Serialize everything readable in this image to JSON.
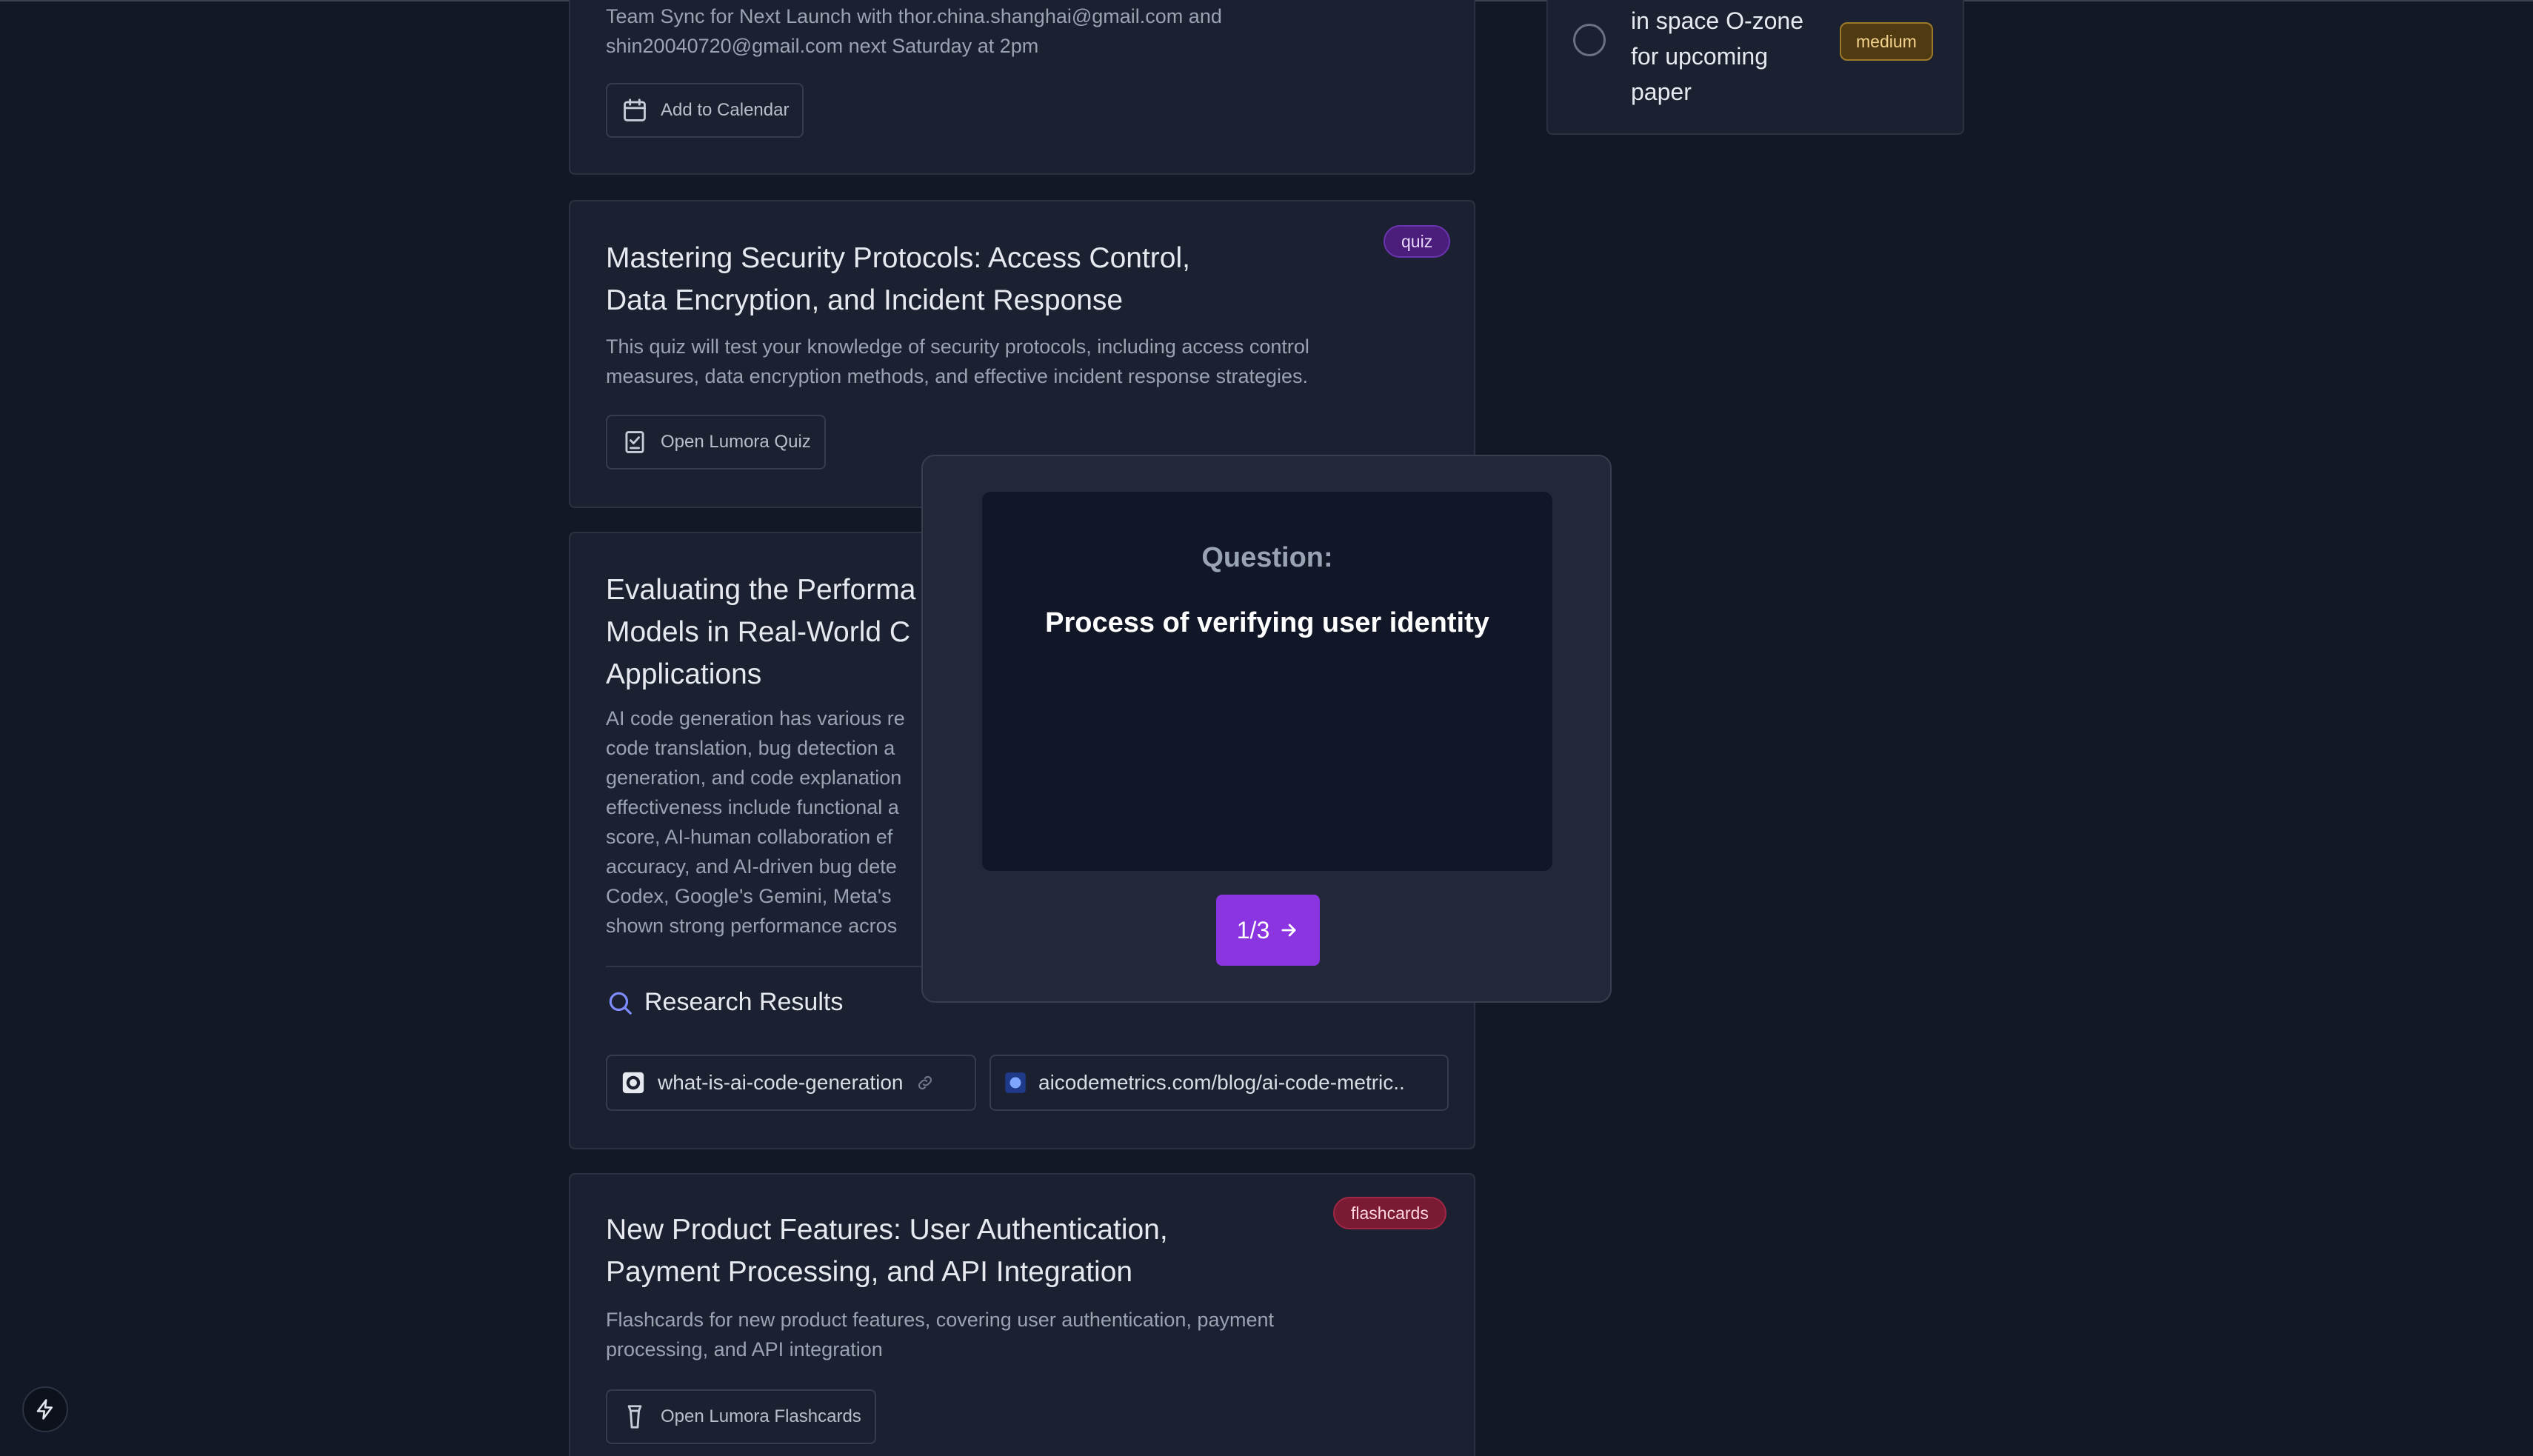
{
  "event_card": {
    "desc_line1": "Team Sync for Next Launch with thor.china.shanghai@gmail.com and",
    "desc_line2": "shin20040720@gmail.com next Saturday at 2pm",
    "button": "Add to Calendar"
  },
  "quiz_card": {
    "badge": "quiz",
    "title_line1": "Mastering Security Protocols: Access Control,",
    "title_line2": "Data Encryption, and Incident Response",
    "desc_line1": "This quiz will test your knowledge of security protocols, including access control",
    "desc_line2": "measures, data encryption methods, and effective incident response strategies.",
    "button": "Open Lumora Quiz"
  },
  "research_card": {
    "title_lines": [
      "Evaluating the Performa",
      "Models in Real-World C",
      "Applications"
    ],
    "desc_lines": [
      "AI code generation has various re",
      "code translation, bug detection a",
      "generation, and code explanation",
      "effectiveness include functional a",
      "score, AI-human collaboration ef",
      "accuracy, and AI-driven bug dete",
      "Codex, Google's Gemini, Meta's",
      "shown strong performance acros"
    ],
    "results_heading": "Research Results",
    "results": [
      {
        "label": "what-is-ai-code-generation",
        "icon": "github-icon"
      },
      {
        "label": "aicodemetrics.com/blog/ai-code-metric..",
        "icon": "site-favicon-icon"
      }
    ]
  },
  "flashcards_card": {
    "badge": "flashcards",
    "title_line1": "New Product Features: User Authentication,",
    "title_line2": "Payment Processing, and API Integration",
    "desc_line1": "Flashcards for new product features, covering user authentication, payment",
    "desc_line2": "processing, and API integration",
    "button": "Open Lumora Flashcards"
  },
  "task_item": {
    "text_lines": [
      "in space O-zone",
      "for upcoming",
      "paper"
    ],
    "priority": "medium"
  },
  "flashcard_overlay": {
    "label": "Question:",
    "question": "Process of verifying user identity",
    "progress": "1/3"
  },
  "colors": {
    "background": "#121826",
    "card": "#1b2130",
    "accent_purple": "#8a35e0"
  }
}
